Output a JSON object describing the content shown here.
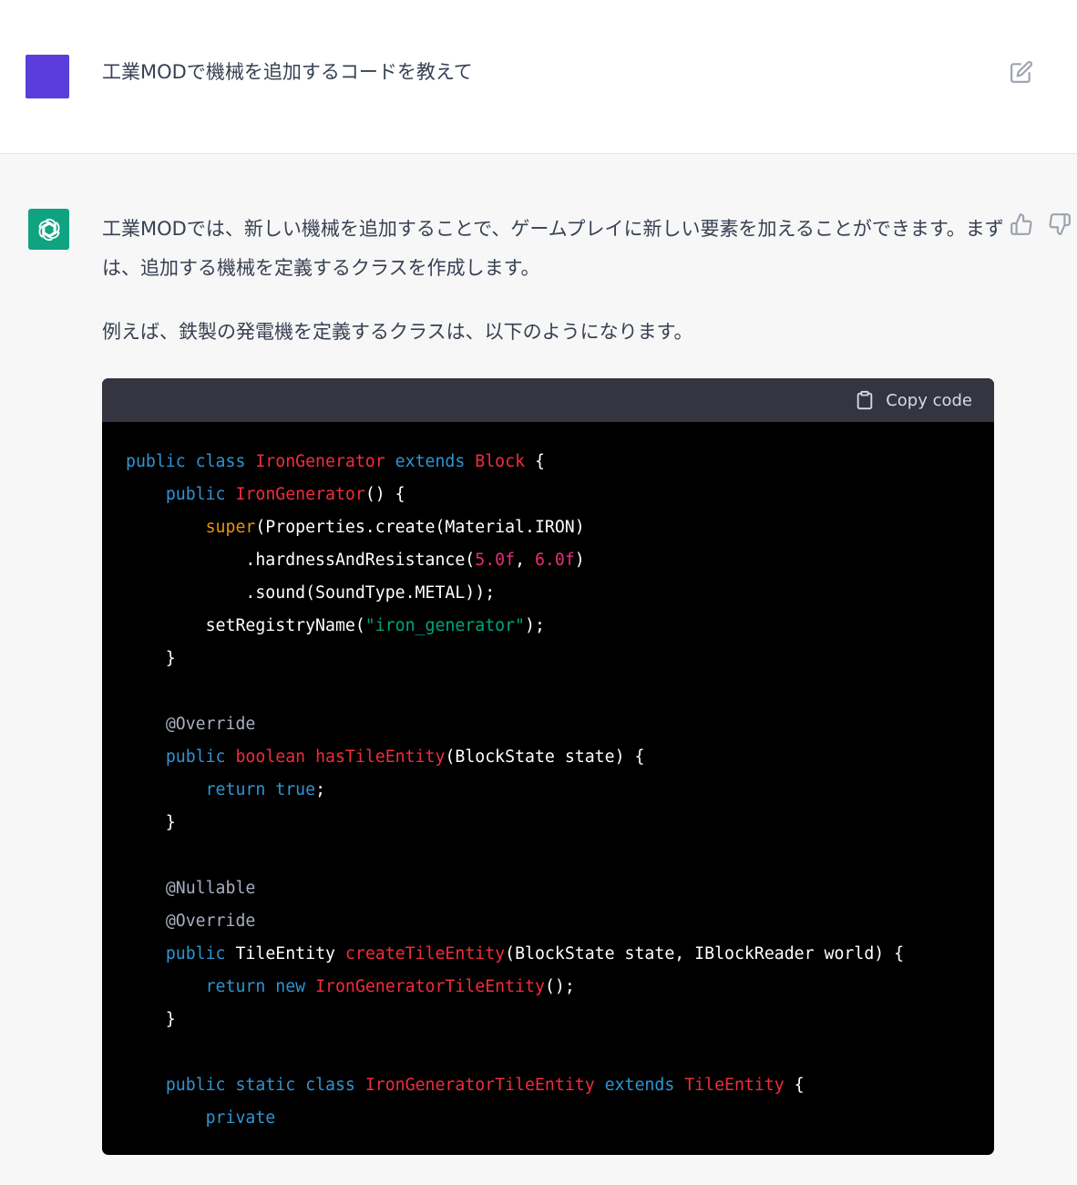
{
  "user_message": {
    "text": "工業MODで機械を追加するコードを教えて",
    "avatar_color": "#5b3ddb"
  },
  "assistant_message": {
    "paragraphs": [
      "工業MODでは、新しい機械を追加することで、ゲームプレイに新しい要素を加えることができます。まずは、追加する機械を定義するクラスを作成します。",
      "例えば、鉄製の発電機を定義するクラスは、以下のようになります。"
    ],
    "avatar_color": "#10a37f"
  },
  "code_block": {
    "copy_label": "Copy code",
    "lines": [
      [
        {
          "t": "public class ",
          "c": "kw"
        },
        {
          "t": "IronGenerator ",
          "c": "tp"
        },
        {
          "t": "extends ",
          "c": "kw"
        },
        {
          "t": "Block",
          "c": "tp"
        },
        {
          "t": " {",
          "c": "pl"
        }
      ],
      [
        {
          "t": "    ",
          "c": "pl"
        },
        {
          "t": "public ",
          "c": "kw"
        },
        {
          "t": "IronGenerator",
          "c": "tp"
        },
        {
          "t": "() {",
          "c": "pl"
        }
      ],
      [
        {
          "t": "        ",
          "c": "pl"
        },
        {
          "t": "super",
          "c": "sp"
        },
        {
          "t": "(Properties.create(Material.IRON)",
          "c": "pl"
        }
      ],
      [
        {
          "t": "            .hardnessAndResistance(",
          "c": "pl"
        },
        {
          "t": "5.0f",
          "c": "nm"
        },
        {
          "t": ", ",
          "c": "pl"
        },
        {
          "t": "6.0f",
          "c": "nm"
        },
        {
          "t": ")",
          "c": "pl"
        }
      ],
      [
        {
          "t": "            .sound(SoundType.METAL));",
          "c": "pl"
        }
      ],
      [
        {
          "t": "        setRegistryName(",
          "c": "pl"
        },
        {
          "t": "\"iron_generator\"",
          "c": "st"
        },
        {
          "t": ");",
          "c": "pl"
        }
      ],
      [
        {
          "t": "    }",
          "c": "pl"
        }
      ],
      [
        {
          "t": "",
          "c": "pl"
        }
      ],
      [
        {
          "t": "    ",
          "c": "pl"
        },
        {
          "t": "@Override",
          "c": "an"
        }
      ],
      [
        {
          "t": "    ",
          "c": "pl"
        },
        {
          "t": "public ",
          "c": "kw"
        },
        {
          "t": "boolean ",
          "c": "tp"
        },
        {
          "t": "hasTileEntity",
          "c": "tp"
        },
        {
          "t": "(BlockState state) {",
          "c": "pl"
        }
      ],
      [
        {
          "t": "        ",
          "c": "pl"
        },
        {
          "t": "return ",
          "c": "kw"
        },
        {
          "t": "true",
          "c": "kw"
        },
        {
          "t": ";",
          "c": "pl"
        }
      ],
      [
        {
          "t": "    }",
          "c": "pl"
        }
      ],
      [
        {
          "t": "",
          "c": "pl"
        }
      ],
      [
        {
          "t": "    ",
          "c": "pl"
        },
        {
          "t": "@Nullable",
          "c": "an"
        }
      ],
      [
        {
          "t": "    ",
          "c": "pl"
        },
        {
          "t": "@Override",
          "c": "an"
        }
      ],
      [
        {
          "t": "    ",
          "c": "pl"
        },
        {
          "t": "public ",
          "c": "kw"
        },
        {
          "t": "TileEntity ",
          "c": "pl"
        },
        {
          "t": "createTileEntity",
          "c": "tp"
        },
        {
          "t": "(BlockState state, IBlockReader world) {",
          "c": "pl"
        }
      ],
      [
        {
          "t": "        ",
          "c": "pl"
        },
        {
          "t": "return ",
          "c": "kw"
        },
        {
          "t": "new ",
          "c": "kw"
        },
        {
          "t": "IronGeneratorTileEntity",
          "c": "tp"
        },
        {
          "t": "();",
          "c": "pl"
        }
      ],
      [
        {
          "t": "    }",
          "c": "pl"
        }
      ],
      [
        {
          "t": "",
          "c": "pl"
        }
      ],
      [
        {
          "t": "    ",
          "c": "pl"
        },
        {
          "t": "public ",
          "c": "kw"
        },
        {
          "t": "static ",
          "c": "kw"
        },
        {
          "t": "class ",
          "c": "kw"
        },
        {
          "t": "IronGeneratorTileEntity ",
          "c": "tp"
        },
        {
          "t": "extends ",
          "c": "kw"
        },
        {
          "t": "TileEntity",
          "c": "tp"
        },
        {
          "t": " {",
          "c": "pl"
        }
      ],
      [
        {
          "t": "        ",
          "c": "pl"
        },
        {
          "t": "private",
          "c": "kw"
        }
      ]
    ]
  },
  "icons": {
    "edit": "edit-icon",
    "thumbs_up": "thumbs-up-icon",
    "thumbs_down": "thumbs-down-icon",
    "clipboard": "clipboard-icon",
    "bot_logo": "openai-logo-icon"
  }
}
